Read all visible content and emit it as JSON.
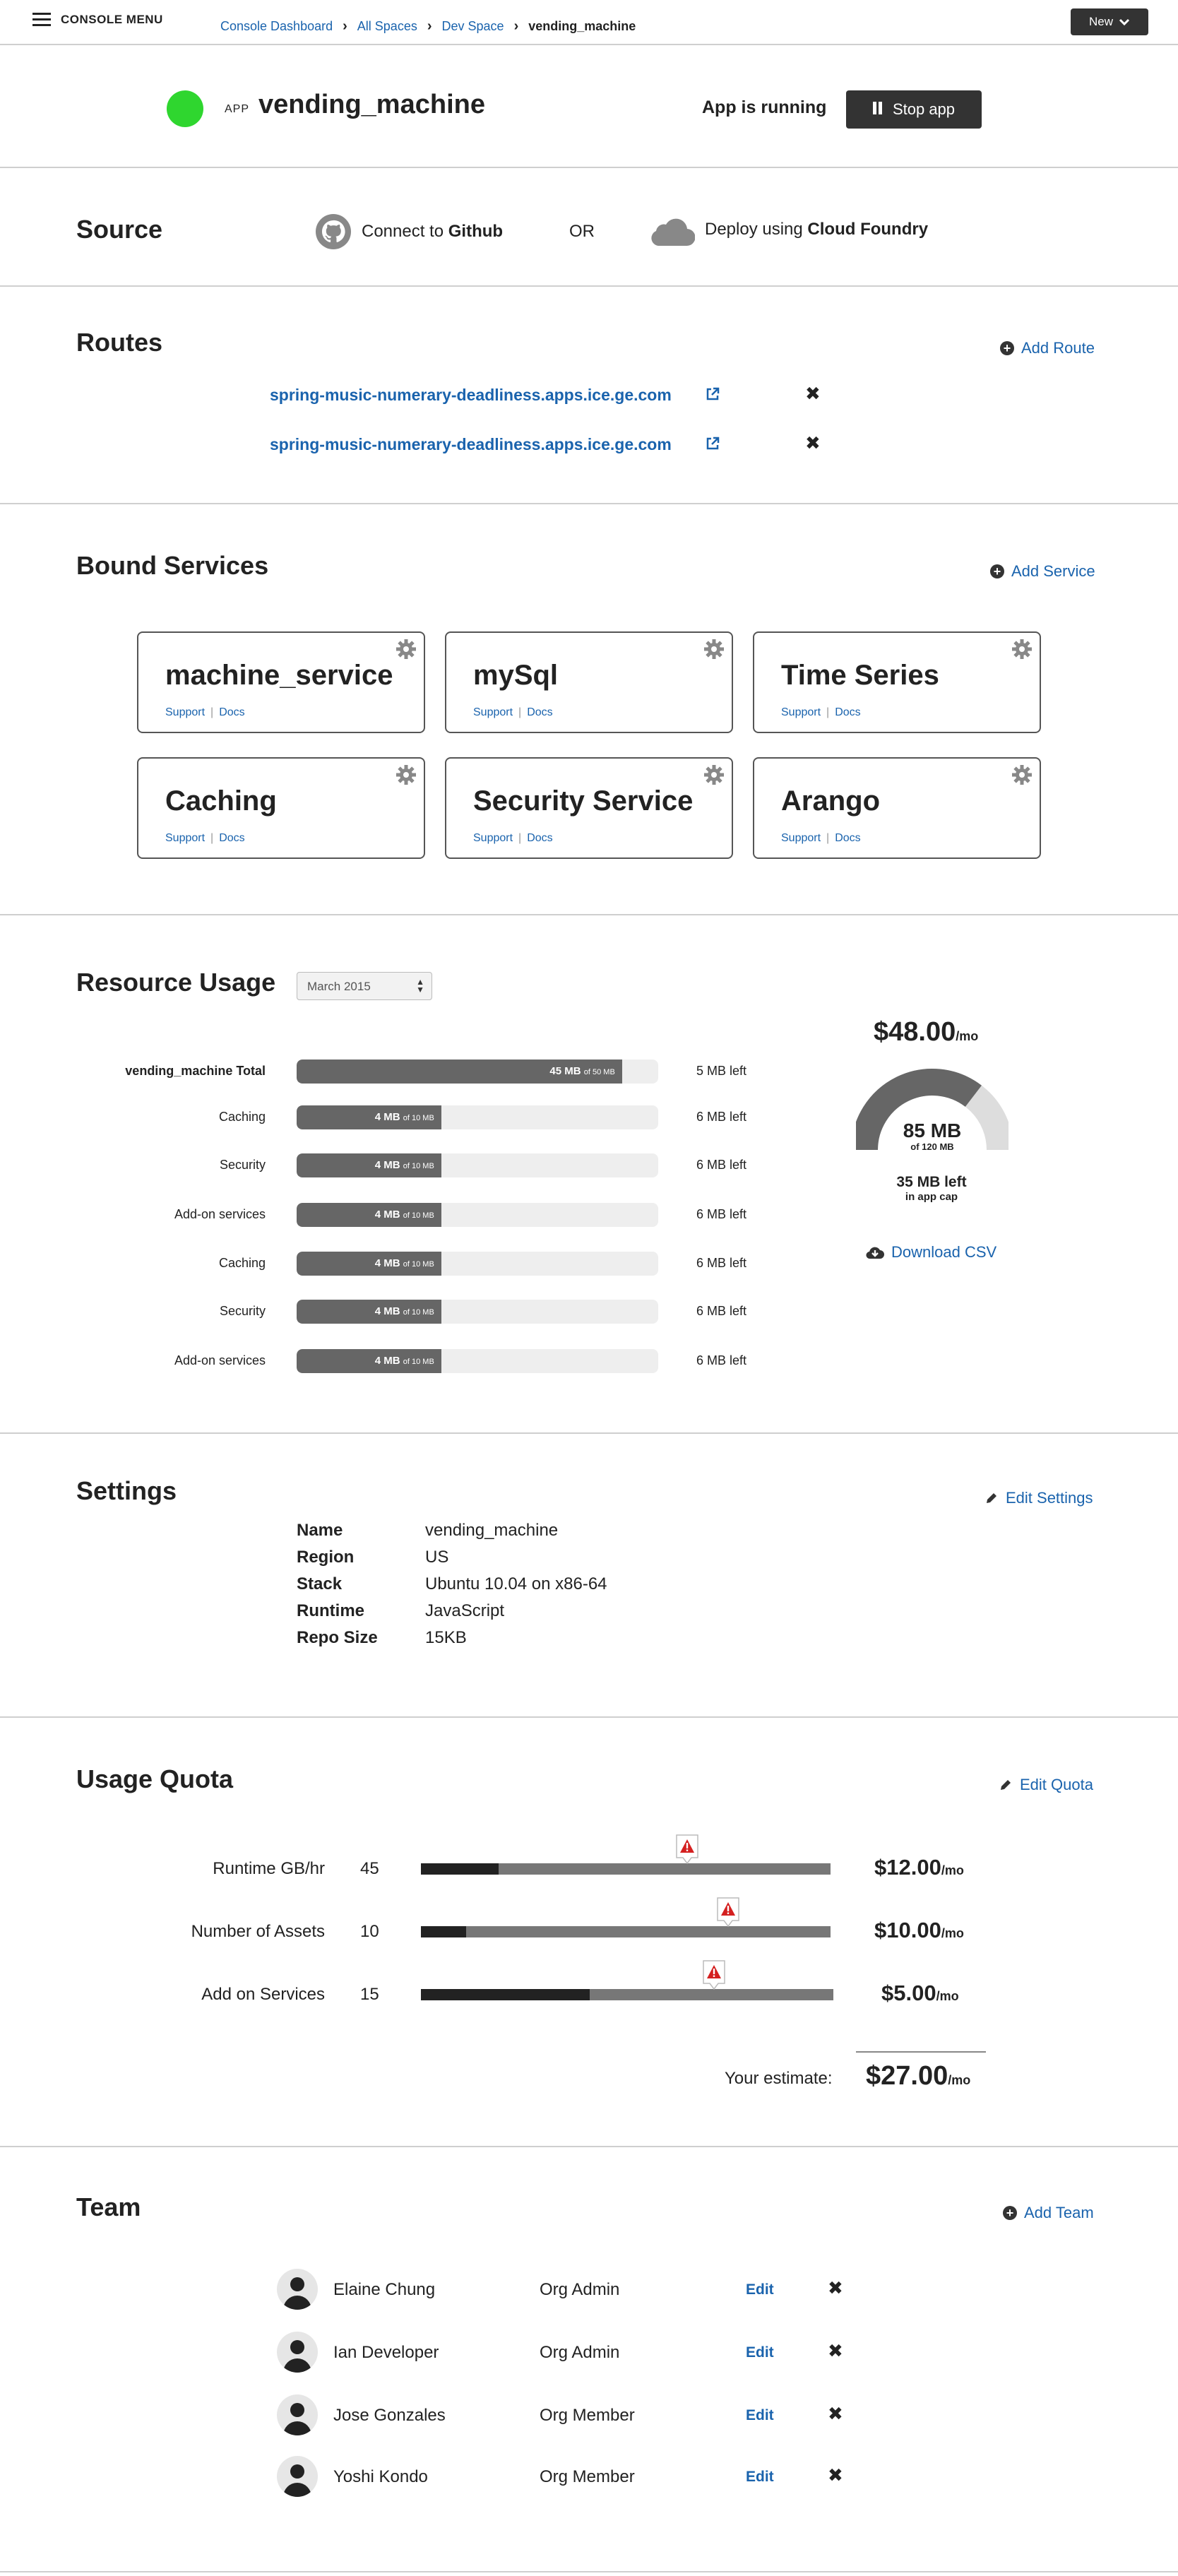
{
  "topbar": {
    "menu_label": "CONSOLE MENU",
    "breadcrumb": [
      "Console Dashboard",
      "All Spaces",
      "Dev Space",
      "vending_machine"
    ],
    "new_label": "New"
  },
  "app": {
    "tag": "APP",
    "name": "vending_machine",
    "status": "App is running",
    "stop_label": "Stop app",
    "status_color": "#2fd62f"
  },
  "source": {
    "title": "Source",
    "github_prefix": "Connect to ",
    "github_strong": "Github",
    "or": "OR",
    "cf_prefix": "Deploy using ",
    "cf_strong": "Cloud Foundry"
  },
  "routes": {
    "title": "Routes",
    "add_label": "Add Route",
    "items": [
      "spring-music-numerary-deadliness.apps.ice.ge.com",
      "spring-music-numerary-deadliness.apps.ice.ge.com"
    ]
  },
  "services": {
    "title": "Bound Services",
    "add_label": "Add Service",
    "support_label": "Support",
    "docs_label": "Docs",
    "items": [
      "machine_service",
      "mySql",
      "Time Series",
      "Caching",
      "Security Service",
      "Arango"
    ]
  },
  "resource": {
    "title": "Resource Usage",
    "month": "March 2015",
    "rows": [
      {
        "label": "vending_machine Total",
        "used": "45 MB",
        "of": "of 50 MB",
        "fraction": 0.9,
        "left": "5 MB left"
      },
      {
        "label": "Caching",
        "used": "4 MB",
        "of": "of 10 MB",
        "fraction": 0.4,
        "left": "6 MB left"
      },
      {
        "label": "Security",
        "used": "4 MB",
        "of": "of 10 MB",
        "fraction": 0.4,
        "left": "6 MB left"
      },
      {
        "label": "Add-on services",
        "used": "4 MB",
        "of": "of 10 MB",
        "fraction": 0.4,
        "left": "6 MB left"
      },
      {
        "label": "Caching",
        "used": "4 MB",
        "of": "of 10 MB",
        "fraction": 0.4,
        "left": "6 MB left"
      },
      {
        "label": "Security",
        "used": "4 MB",
        "of": "of 10 MB",
        "fraction": 0.4,
        "left": "6 MB left"
      },
      {
        "label": "Add-on services",
        "used": "4 MB",
        "of": "of 10 MB",
        "fraction": 0.4,
        "left": "6 MB left"
      }
    ],
    "price": "$48.00",
    "price_unit": "/mo",
    "donut_value": "85 MB",
    "donut_of": "of 120 MB",
    "donut_fraction": 0.708,
    "left_line1": "35 MB left",
    "left_line2": "in app cap",
    "download_label": "Download CSV"
  },
  "settings": {
    "title": "Settings",
    "edit_label": "Edit Settings",
    "rows": [
      {
        "key": "Name",
        "value": "vending_machine"
      },
      {
        "key": "Region",
        "value": "US"
      },
      {
        "key": "Stack",
        "value": "Ubuntu 10.04 on x86-64"
      },
      {
        "key": "Runtime",
        "value": "JavaScript"
      },
      {
        "key": "Repo Size",
        "value": "15KB"
      }
    ]
  },
  "quota": {
    "title": "Usage Quota",
    "edit_label": "Edit Quota",
    "rows": [
      {
        "label": "Runtime GB/hr",
        "value": "45",
        "fill": 0.19,
        "warn": 0.65,
        "price": "$12.00",
        "unit": "/mo"
      },
      {
        "label": "Number of Assets",
        "value": "10",
        "fill": 0.11,
        "warn": 0.75,
        "price": "$10.00",
        "unit": "/mo"
      },
      {
        "label": "Add on Services",
        "value": "15",
        "fill": 0.41,
        "warn": 0.71,
        "price": "$5.00",
        "unit": "/mo"
      }
    ],
    "estimate_label": "Your estimate:",
    "estimate": "$27.00",
    "estimate_unit": "/mo",
    "warn_color": "#d42020"
  },
  "team": {
    "title": "Team",
    "add_label": "Add Team",
    "edit_label": "Edit",
    "members": [
      {
        "name": "Elaine Chung",
        "role": "Org Admin"
      },
      {
        "name": "Ian Developer",
        "role": "Org Admin"
      },
      {
        "name": "Jose Gonzales",
        "role": "Org Member"
      },
      {
        "name": "Yoshi Kondo",
        "role": "Org Member"
      }
    ]
  }
}
